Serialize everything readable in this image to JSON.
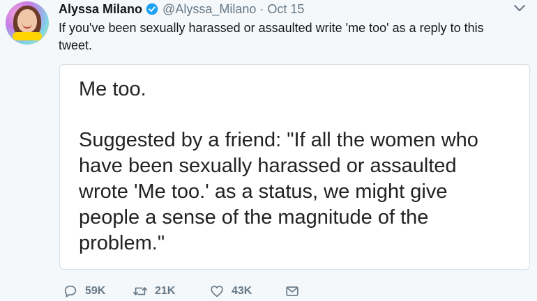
{
  "tweet": {
    "author_name": "Alyssa Milano",
    "handle": "@Alyssa_Milano",
    "separator": "·",
    "date": "Oct 15",
    "text_line1": "If you've been sexually harassed or assaulted write 'me too' as a reply to this",
    "text_line2": "tweet."
  },
  "card": {
    "lines": [
      "Me too.",
      "Suggested by a friend: \"If all the women who",
      "have been sexually harassed or assaulted",
      "wrote 'Me too.' as a status, we might give",
      "people a sense of the magnitude of the",
      "problem.\""
    ]
  },
  "actions": {
    "replies": "59K",
    "retweets": "21K",
    "likes": "43K"
  },
  "icons": {
    "verified": "verified-badge-icon",
    "menu": "chevron-down-icon",
    "reply": "reply-icon",
    "retweet": "retweet-icon",
    "like": "heart-icon",
    "message": "envelope-icon"
  },
  "colors": {
    "background": "#f5f8fa",
    "verified_blue": "#1da1f2",
    "secondary_text": "#657786",
    "primary_text": "#14171a"
  }
}
